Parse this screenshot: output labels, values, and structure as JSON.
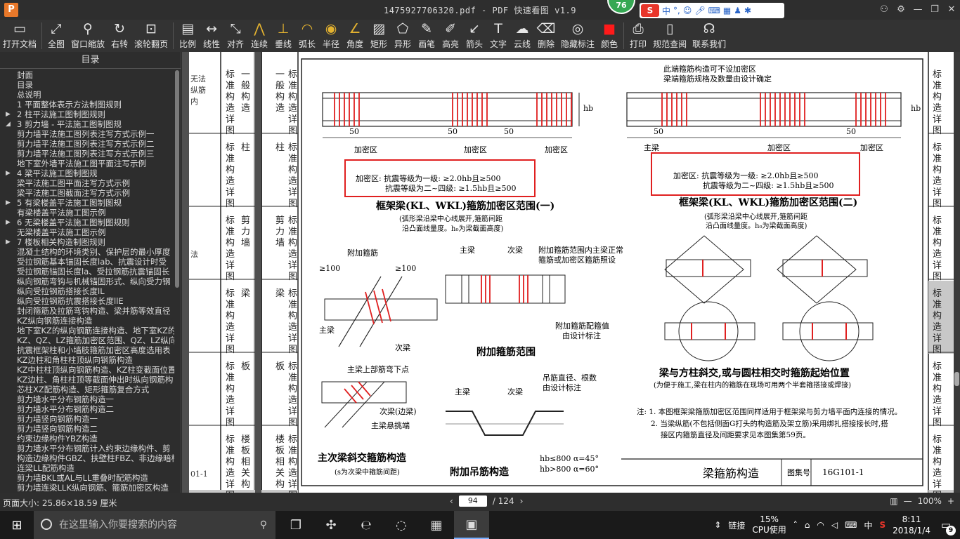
{
  "window": {
    "logo": "P",
    "title": "1475927706320.pdf - PDF 快速看图 v1.9",
    "badge": "76"
  },
  "ime": {
    "logo": "S",
    "lang": "中",
    "punct": "°,",
    "items": [
      "emoji-icon",
      "mic-icon",
      "keyboard-icon",
      "grid-icon",
      "shirt-icon",
      "wrench-icon"
    ]
  },
  "toolbar": [
    {
      "label": "打开文档",
      "icon": "folder-icon",
      "glyph": "▭"
    },
    {
      "sep": true
    },
    {
      "label": "全图",
      "icon": "fit-icon",
      "glyph": "⤢"
    },
    {
      "label": "窗口缩放",
      "icon": "magnifier-icon",
      "glyph": "⚲"
    },
    {
      "label": "右转",
      "icon": "rotate-icon",
      "glyph": "↻"
    },
    {
      "label": "滚轮翻页",
      "icon": "mouse-icon",
      "glyph": "⊡"
    },
    {
      "sep": true
    },
    {
      "label": "比例",
      "icon": "ruler-icon",
      "glyph": "▤"
    },
    {
      "label": "线性",
      "icon": "linear-measure-icon",
      "glyph": "↔"
    },
    {
      "label": "对齐",
      "icon": "aligned-measure-icon",
      "glyph": "⤡"
    },
    {
      "label": "连续",
      "icon": "continuous-icon",
      "glyph": "⋀",
      "color": "y"
    },
    {
      "label": "垂线",
      "icon": "perpendicular-icon",
      "glyph": "⊥",
      "color": "y"
    },
    {
      "label": "弧长",
      "icon": "arc-icon",
      "glyph": "◠",
      "color": "y"
    },
    {
      "label": "半径",
      "icon": "radius-icon",
      "glyph": "◉",
      "color": "y"
    },
    {
      "label": "角度",
      "icon": "angle-icon",
      "glyph": "∠",
      "color": "y"
    },
    {
      "label": "矩形",
      "icon": "rectangle-icon",
      "glyph": "▨"
    },
    {
      "label": "异形",
      "icon": "polygon-icon",
      "glyph": "⬠"
    },
    {
      "label": "画笔",
      "icon": "pen-icon",
      "glyph": "✎"
    },
    {
      "label": "高亮",
      "icon": "highlighter-icon",
      "glyph": "✐"
    },
    {
      "label": "箭头",
      "icon": "arrow-icon",
      "glyph": "↙"
    },
    {
      "label": "文字",
      "icon": "text-icon",
      "glyph": "T"
    },
    {
      "label": "云线",
      "icon": "cloud-icon",
      "glyph": "☁"
    },
    {
      "label": "删除",
      "icon": "eraser-icon",
      "glyph": "⌫"
    },
    {
      "label": "隐藏标注",
      "icon": "eye-hide-icon",
      "glyph": "◎"
    },
    {
      "label": "颜色",
      "icon": "color-swatch-icon",
      "glyph": "■",
      "color": "r"
    },
    {
      "sep": true
    },
    {
      "label": "打印",
      "icon": "printer-icon",
      "glyph": "⎙"
    },
    {
      "label": "规范查阅",
      "icon": "book-icon",
      "glyph": "▯"
    },
    {
      "label": "联系我们",
      "icon": "support-icon",
      "glyph": "☊"
    }
  ],
  "sidebar": {
    "title": "目录",
    "items": [
      {
        "t": "封面"
      },
      {
        "t": "目录"
      },
      {
        "t": "总说明"
      },
      {
        "t": "1 平面整体表示方法制图规则"
      },
      {
        "t": "2 柱平法施工图制图规则",
        "caret": "▶"
      },
      {
        "t": "3 剪力墙 - 平法施工图制图规",
        "caret": "◢"
      },
      {
        "t": "剪力墙平法施工图列表注写方式示例一"
      },
      {
        "t": "剪力墙平法施工图列表注写方式示例二"
      },
      {
        "t": "剪力墙平法施工图列表注写方式示例三"
      },
      {
        "t": "地下室外墙平法施工图平面注写示例"
      },
      {
        "t": "4 梁平法施工图制图规",
        "caret": "▶"
      },
      {
        "t": "梁平法施工图平面注写方式示例"
      },
      {
        "t": "梁平法施工图截面注写方式示例"
      },
      {
        "t": "5 有梁楼盖平法施工图制图规",
        "caret": "▶"
      },
      {
        "t": "有梁楼盖平法施工图示例"
      },
      {
        "t": "6 无梁楼盖平法施工图制图规则",
        "caret": "▶"
      },
      {
        "t": "无梁楼盖平法施工图示例"
      },
      {
        "t": "7 楼板相关构造制图规则",
        "caret": "▶"
      },
      {
        "t": "混凝土结构的环境类别、保护层的最小厚度"
      },
      {
        "t": "受拉钢筋基本锚固长度lab、抗震设计时受"
      },
      {
        "t": "受拉钢筋锚固长度la、受拉钢筋抗震锚固长"
      },
      {
        "t": "纵向钢筋弯钩与机械锚固形式、纵向受力钢"
      },
      {
        "t": "纵向受拉钢筋搭接长度lL"
      },
      {
        "t": "纵向受拉钢筋抗震搭接长度llE"
      },
      {
        "t": "封闭箍筋及拉筋弯钩构造、梁并筋等效直径"
      },
      {
        "t": "KZ纵向钢筋连接构造"
      },
      {
        "t": "地下室KZ的纵向钢筋连接构造、地下室KZ的"
      },
      {
        "t": "KZ、QZ、LZ箍筋加密区范围、QZ、LZ纵向钢"
      },
      {
        "t": "抗震框架柱和小墙肢箍筋加密区高度选用表"
      },
      {
        "t": "KZ边柱和角柱柱顶纵向钢筋构造"
      },
      {
        "t": "KZ中柱柱顶纵向钢筋构造、KZ柱变截面位置"
      },
      {
        "t": "KZ边柱、角柱柱顶等截面伸出时纵向钢筋构"
      },
      {
        "t": "芯柱XZ配筋构造、矩形箍筋复合方式"
      },
      {
        "t": "剪力墙水平分布钢筋构造一"
      },
      {
        "t": "剪力墙水平分布钢筋构造二"
      },
      {
        "t": "剪力墙竖向钢筋构造一"
      },
      {
        "t": "剪力墙竖向钢筋构造二"
      },
      {
        "t": "约束边缘构件YBZ构造"
      },
      {
        "t": "剪力墙水平分布钢筋计入约束边缘构件、剪"
      },
      {
        "t": "构造边缘构件GBZ、扶壁柱FBZ、非边缘暗柱"
      },
      {
        "t": "连梁LL配筋构造"
      },
      {
        "t": "剪力墙BKL或AL与LL重叠时配筋构造"
      },
      {
        "t": "剪力墙连梁LLK纵向钢筋、箍筋加密区构造"
      }
    ]
  },
  "status": {
    "page_size": "页面大小: 25.86×18.59 厘米",
    "prev": "‹",
    "next": "›",
    "page": "94",
    "total": "/ 124",
    "zoom": "100%",
    "zoom_minus": "—",
    "zoom_plus": "+"
  },
  "doc": {
    "left_page": {
      "cut1": "无法",
      "cut2": "纵筋",
      "cut3": "内",
      "cut4": "法",
      "cut5": "01-1"
    },
    "tabs": [
      {
        "a": "标准构造详图",
        "b": "一般构造"
      },
      {
        "a": "标准构造详图",
        "b": "柱"
      },
      {
        "a": "标准构造详图",
        "b": "剪力墙"
      },
      {
        "a": "标准构造详图",
        "b": "梁"
      },
      {
        "a": "标准构造详图",
        "b": "板"
      },
      {
        "a": "标准构造详图",
        "b": "楼板相关构"
      }
    ],
    "fig1_title": "框架梁(KL、WKL)箍筋加密区范围(一)",
    "fig1_note1": "(弧形梁沿梁中心线展开,箍筋间距",
    "fig1_note2": "沿凸面线量度。h₀为梁截面高度)",
    "fig1_box1": "加密区: 抗震等级为一级: ≥2.0hb且≥500",
    "fig1_box2": "抗震等级为二~四级: ≥1.5hb且≥500",
    "fig2_top1": "此端箍筋构造可不设加密区",
    "fig2_top2": "梁端箍筋规格及数量由设计确定",
    "fig2_title": "框架梁(KL、WKL)箍筋加密区范围(二)",
    "fig2_note1": "(弧形梁沿梁中心线展开,箍筋间距",
    "fig2_note2": "沿凸面线量度。h₀为梁截面高度)",
    "fig2_beam": "主梁",
    "dense": "加密区",
    "dim50": "50",
    "hb": "hb",
    "fig3_title": "附加箍筋范围",
    "fig3_a": "附加箍筋",
    "fig3_b": "主梁",
    "fig3_c": "次梁",
    "fig3_d": "附加箍筋范围内主梁正常",
    "fig3_e": "箍筋或加密区箍筋照设",
    "fig3_f": "附加箍筋配箍值",
    "fig3_g": "由设计标注",
    "fig3_h": "≥100",
    "fig4_title": "梁与方柱斜交,或与圆柱相交时箍筋起始位置",
    "fig4_note": "(为便于施工,梁在柱内的箍筋在现场可用两个半套箍搭接或焊接)",
    "fig5_title": "主次梁斜交箍筋构造",
    "fig5_note": "(s为次梁中箍筋间距)",
    "fig5_a": "主梁上部筋弯下点",
    "fig5_b": "次梁(边梁)",
    "fig5_c": "主梁悬挑端",
    "fig6_title": "附加吊筋构造",
    "fig6_a": "吊筋直径、根数",
    "fig6_b": "由设计标注",
    "fig6_c": "hb≤800 α=45°",
    "fig6_d": "hb>800 α=60°",
    "notes1": "注: 1. 本图框架梁箍筋加密区范围同样适用于框架梁与剪力墙平面内连接的情况。",
    "notes2": "2. 当梁纵筋(不包括侧面G打头的构造筋及架立筋)采用绑扎搭接接长时,搭",
    "notes3": "接区内箍筋直径及间距要求见本图集第59页。",
    "footer_title": "梁箍筋构造",
    "footer_atlas": "图集号",
    "footer_code": "16G101-1"
  },
  "taskbar": {
    "search_placeholder": "在这里输入你要搜索的内容",
    "cpu_pct": "15%",
    "cpu_label": "CPU使用",
    "link": "链接",
    "ime": "中",
    "time": "8:11",
    "date": "2018/1/4",
    "notif_count": "9"
  },
  "colors": {
    "accent_red": "#e02020",
    "toolbar_bg": "#333333"
  }
}
